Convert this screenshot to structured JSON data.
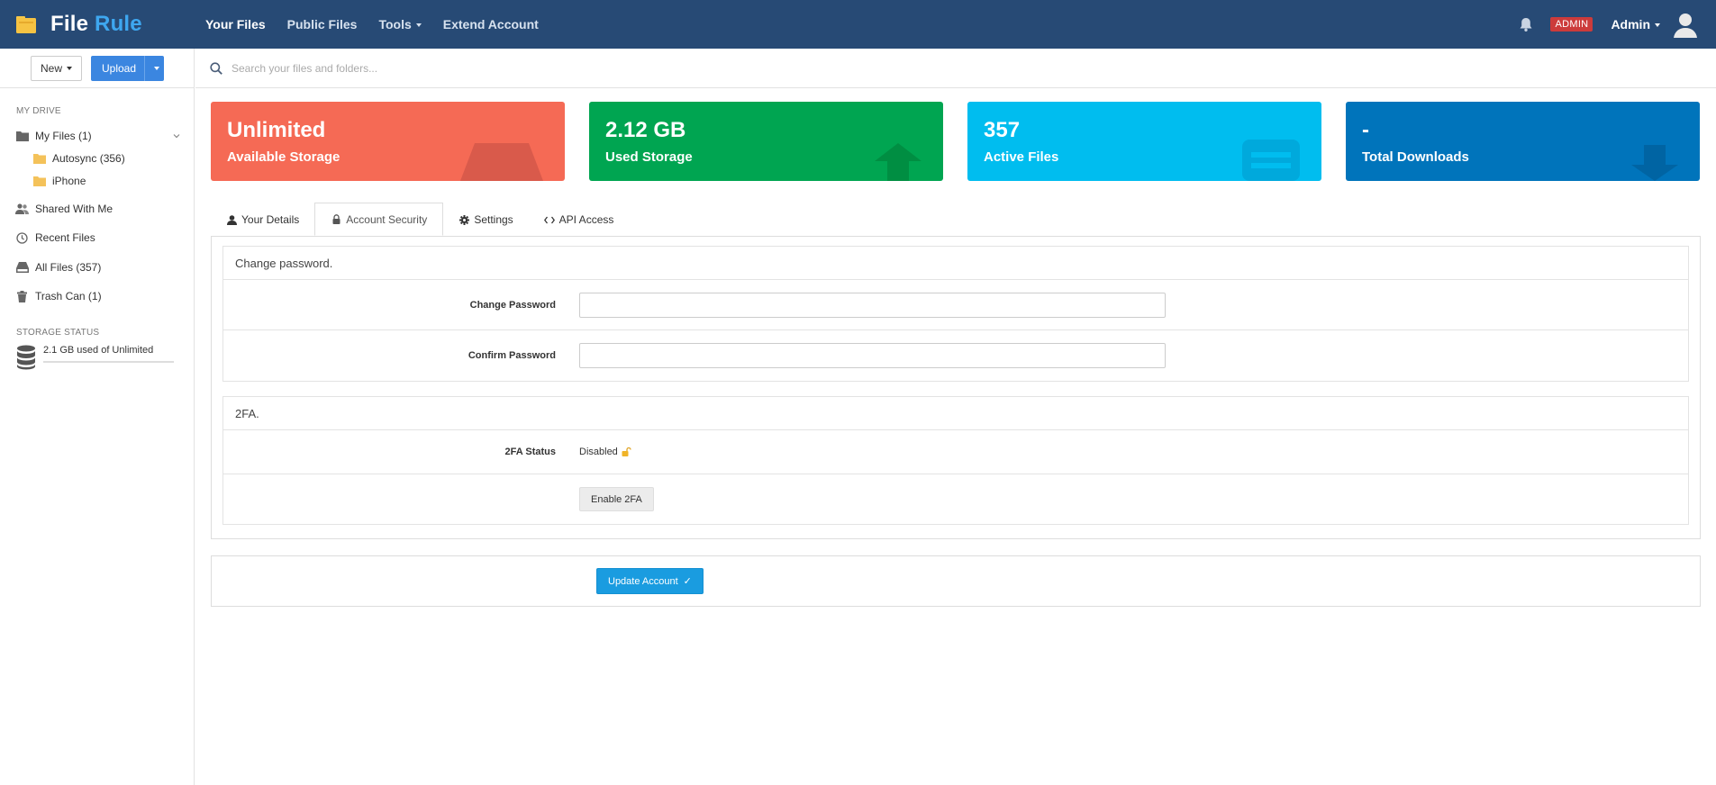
{
  "brand": {
    "name_part1": "File",
    "name_part2": "Rule"
  },
  "nav": {
    "your_files": "Your Files",
    "public_files": "Public Files",
    "tools": "Tools",
    "extend_account": "Extend Account",
    "admin_badge": "ADMIN",
    "user": "Admin"
  },
  "toolbar": {
    "new_label": "New",
    "upload_label": "Upload"
  },
  "search": {
    "placeholder": "Search your files and folders..."
  },
  "sidebar": {
    "my_drive_title": "MY DRIVE",
    "my_files": "My Files (1)",
    "folders": [
      "Autosync (356)",
      "iPhone"
    ],
    "shared": "Shared With Me",
    "recent": "Recent Files",
    "all_files": "All Files (357)",
    "trash": "Trash Can (1)",
    "storage_title": "STORAGE STATUS",
    "storage_text": "2.1 GB used of Unlimited"
  },
  "cards": [
    {
      "value": "Unlimited",
      "label": "Available Storage",
      "color": "#f56a55",
      "icon": "drive-icon"
    },
    {
      "value": "2.12 GB",
      "label": "Used Storage",
      "color": "#00a551",
      "icon": "upload-arrow-icon"
    },
    {
      "value": "357",
      "label": "Active Files",
      "color": "#00bdef",
      "icon": "file-icon"
    },
    {
      "value": "-",
      "label": "Total Downloads",
      "color": "#0074bb",
      "icon": "download-arrow-icon"
    }
  ],
  "tabs": [
    "Your Details",
    "Account Security",
    "Settings",
    "API Access"
  ],
  "security": {
    "password_section": "Change password.",
    "change_password_label": "Change Password",
    "confirm_password_label": "Confirm Password",
    "twofa_section": "2FA.",
    "twofa_status_label": "2FA Status",
    "twofa_status_value": "Disabled",
    "enable_2fa": "Enable 2FA"
  },
  "update_button": "Update Account",
  "colors": {
    "navbar": "#274a75",
    "accent": "#3ea7f0",
    "upload": "#3b86e0",
    "update": "#1a9ce0",
    "admin_badge": "#cc3b3b"
  }
}
